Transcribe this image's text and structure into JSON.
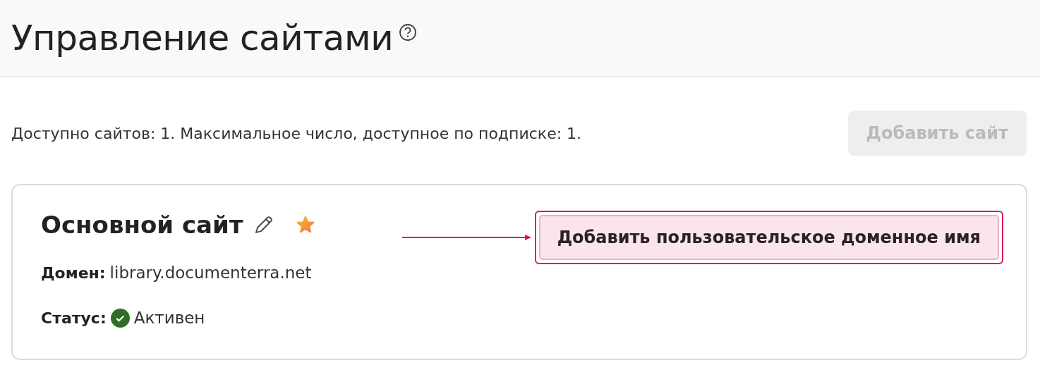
{
  "header": {
    "title": "Управление сайтами"
  },
  "summary": "Доступно сайтов: 1. Максимальное число, доступное по подписке: 1.",
  "add_site_button": {
    "label": "Добавить сайт",
    "disabled": true
  },
  "site": {
    "name": "Основной сайт",
    "favorite": true,
    "domain_label": "Домен:",
    "domain": "library.documenterra.net",
    "status_label": "Статус:",
    "status": "Активен",
    "active": true,
    "custom_domain_button": {
      "label": "Добавить пользовательское доменное имя",
      "highlighted": true
    }
  }
}
